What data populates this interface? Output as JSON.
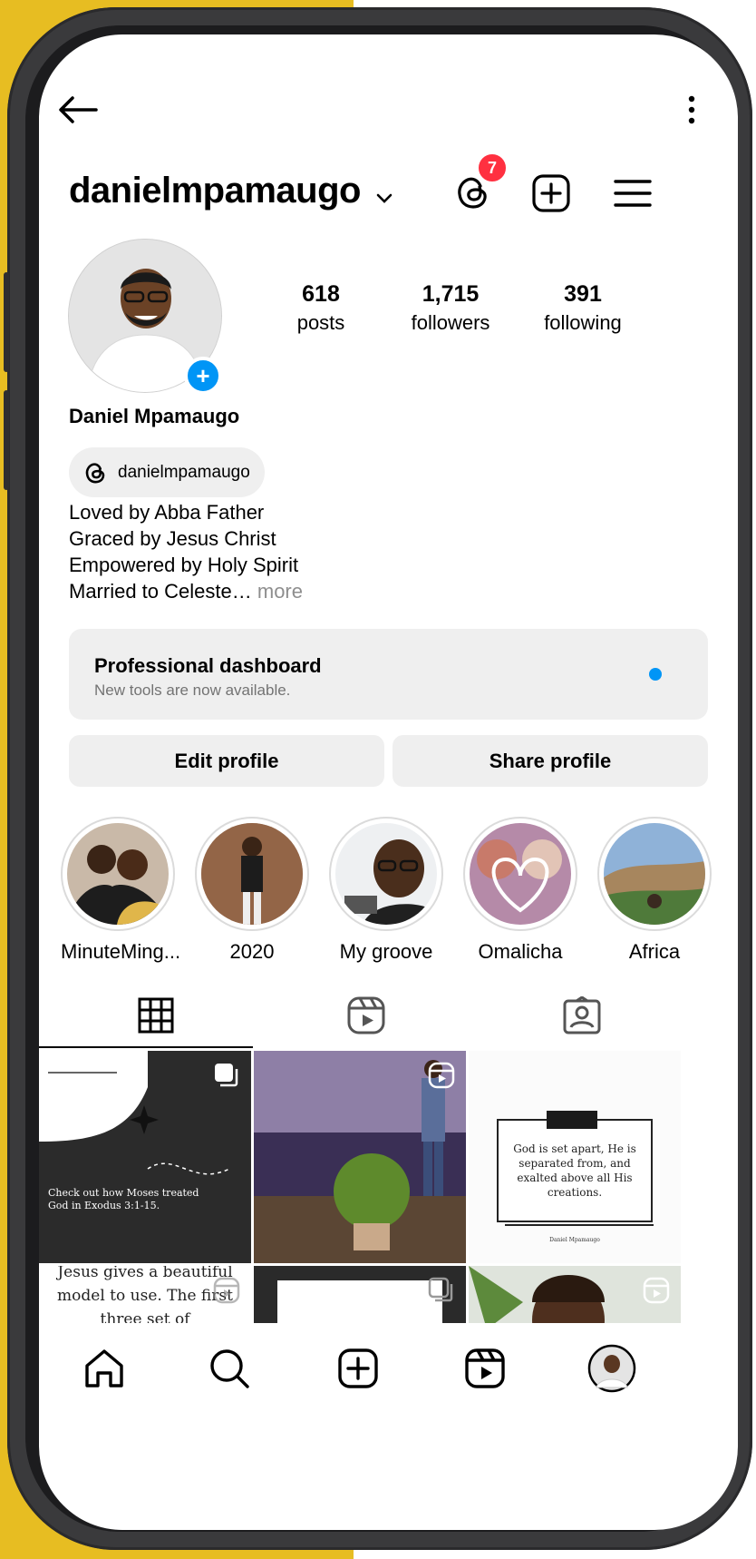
{
  "header": {
    "username": "danielmpamaugo",
    "threads_badge_count": "7"
  },
  "profile": {
    "full_name": "Daniel Mpamaugo",
    "threads_handle": "danielmpamaugo",
    "stats": [
      {
        "value": "618",
        "label": "posts"
      },
      {
        "value": "1,715",
        "label": "followers"
      },
      {
        "value": "391",
        "label": "following"
      }
    ],
    "bio": [
      "Loved by Abba Father",
      "Graced by Jesus Christ",
      "Empowered by Holy Spirit",
      "Married to Celeste…"
    ],
    "bio_more": "more"
  },
  "dashboard": {
    "title": "Professional dashboard",
    "subtitle": "New tools are now available."
  },
  "actions": {
    "edit_profile": "Edit profile",
    "share_profile": "Share profile"
  },
  "highlights": [
    {
      "label": "MinuteMing..."
    },
    {
      "label": "2020"
    },
    {
      "label": "My groove"
    },
    {
      "label": "Omalicha"
    },
    {
      "label": "Africa"
    }
  ],
  "posts": {
    "post1_caption": "Check out how Moses treated God in Exodus 3:1-15.",
    "post3_quote": "God is set apart, He is separated from, and exalted above all His creations.",
    "post3_signature": "Daniel Mpamaugo",
    "post4_text": "Jesus gives a beautiful model to use. The first three set of"
  },
  "colors": {
    "accent_blue": "#0095f6",
    "badge_red": "#ff3040",
    "frame_yellow": "#e7bd22",
    "muted_text": "#737373"
  }
}
